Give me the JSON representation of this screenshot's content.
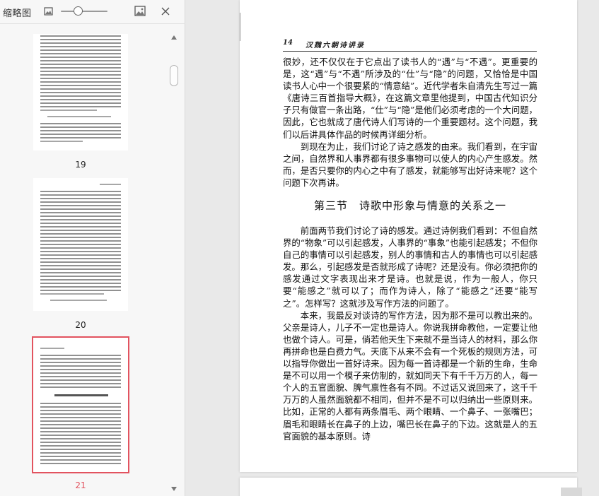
{
  "sidebar": {
    "title": "缩略图",
    "icons": {
      "zoom_out": "small-image-icon",
      "zoom_in": "large-image-icon",
      "close": "close-icon"
    },
    "zoom_level": 0.3,
    "thumbnails": [
      {
        "page_number": "19",
        "selected": false
      },
      {
        "page_number": "20",
        "selected": false
      },
      {
        "page_number": "21",
        "selected": true
      }
    ]
  },
  "document": {
    "running_head": {
      "page": "14",
      "title": "汉魏六朝诗讲录"
    },
    "top_paragraphs": [
      {
        "indent": false,
        "text": "很妙，还不仅仅在于它点出了读书人的“遇”与“不遇”。更重要的是，这“遇”与“不遇”所涉及的“仕”与“隐”的问题，又恰恰是中国读书人心中一个很要紧的“情意结”。近代学者朱自清先生写过一篇《唐诗三百首指导大概》，在这篇文章里他提到，中国古代知识分子只有做官一条出路，“仕”与“隐”是他们必须考虑的一个大问题，因此，它也就成了唐代诗人们写诗的一个重要题材。这个问题，我们以后讲具体作品的时候再详细分析。"
      },
      {
        "indent": true,
        "text": "到现在为止，我们讨论了诗之感发的由来。我们看到，在宇宙之间，自然界和人事界都有很多事物可以使人的内心产生感发。然而，是否只要你的内心之中有了感发，就能够写出好诗来呢？这个问题下次再讲。"
      }
    ],
    "section_title": "第三节　诗歌中形象与情意的关系之一",
    "bottom_paragraphs": [
      {
        "indent": true,
        "text": "前面两节我们讨论了诗的感发。通过诗例我们看到：不但自然界的“物象”可以引起感发，人事界的“事象”也能引起感发；不但你自己的事情可以引起感发，别人的事情和古人的事情也可以引起感发。那么，引起感发是否就形成了诗呢？还是没有。你必须把你的感发通过文字表现出来才是诗。也就是说，作为一般人，你只要“能感之”就可以了；而作为诗人，除了“能感之”还要“能写之”。怎样写？这就涉及写作方法的问题了。"
      },
      {
        "indent": true,
        "text": "本来，我最反对谈诗的写作方法，因为那不是可以教出来的。父亲是诗人，儿子不一定也是诗人。你说我拼命教他，一定要让他也做个诗人。可是，倘若他天生下来就不是当诗人的材料，那么你再拼命也是白费力气。天底下从来不会有一个死板的规则方法，可以指导你做出一首好诗来。因为每一首诗都是一个新的生命，生命是不可以用一个模子来仿制的，就如同天下有千千万万的人，每一个人的五官面貌、脾气禀性各有不同。不过话又说回来了，这千千万万的人虽然面貌都不相同，但并不是不可以归纳出一些原则来。比如，正常的人都有两条眉毛、两个眼睛、一个鼻子、一张嘴巴；眉毛和眼睛长在鼻子的上边，嘴巴长在鼻子的下边。这就是人的五官面貌的基本原则。诗"
      }
    ]
  }
}
